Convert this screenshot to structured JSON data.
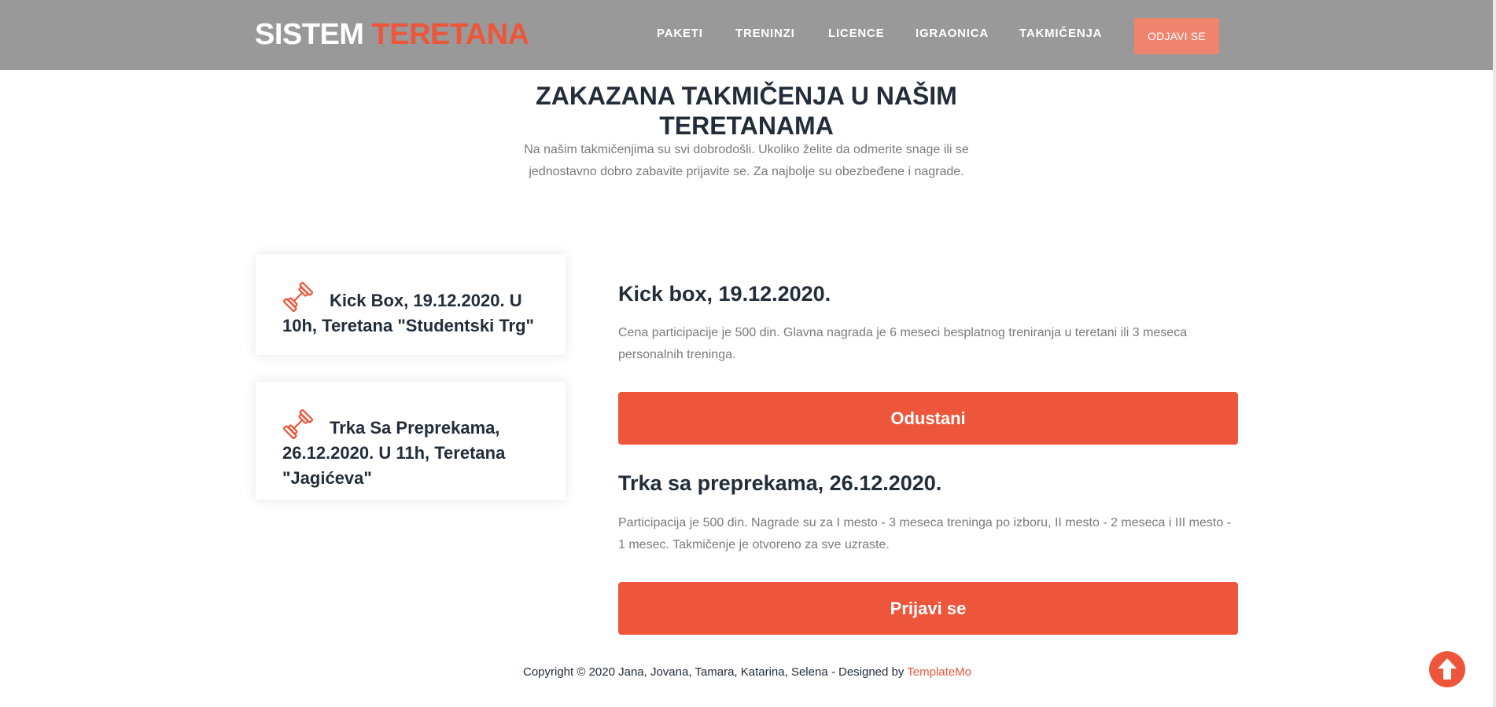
{
  "header": {
    "logo_part1": "SISTEM",
    "logo_part2": "TERETANA",
    "nav": {
      "paketi": "PAKETI",
      "treninzi": "TRENINZI",
      "licence": "LICENCE",
      "igraonica": "IGRAONICA",
      "takmicenja": "TAKMIČENJA"
    },
    "logout_label": "ODJAVI SE"
  },
  "section": {
    "title": "ZAKAZANA TAKMIČENJA U NAŠIM TERETANAMA",
    "subtitle": "Na našim takmičenjima su svi dobrodošli. Ukoliko želite da odmerite snage ili se jednostavno dobro zabavite prijavite se. Za najbolje su obezbeđene i nagrade."
  },
  "cards": [
    {
      "title": "Kick Box, 19.12.2020. U 10h, Teretana \"Studentski Trg\"",
      "icon": "dumbbell-icon"
    },
    {
      "title": "Trka Sa Preprekama, 26.12.2020. U 11h, Teretana \"Jagićeva\"",
      "icon": "dumbbell-icon"
    }
  ],
  "events": [
    {
      "title": "Kick box, 19.12.2020.",
      "description": "Cena participacije je 500 din. Glavna nagrada je 6 meseci besplatnog treniranja u teretani ili 3 meseca personalnih treninga.",
      "button_label": "Odustani"
    },
    {
      "title": "Trka sa preprekama, 26.12.2020.",
      "description": "Participacija je 500 din. Nagrade su za I mesto - 3 meseca treninga po izboru, II mesto - 2 meseca i III mesto - 1 mesec. Takmičenje je otvoreno za sve uzraste.",
      "button_label": "Prijavi se"
    }
  ],
  "footer": {
    "copyright": "Copyright © 2020 Jana, Jovana, Tamara, Katarina, Selena - Designed by",
    "designer_link": "TemplateMo"
  },
  "colors": {
    "accent": "#ed563b",
    "header_bg": "#999999",
    "logout_bg": "#f0846f",
    "heading": "#232d39",
    "text_muted": "#7a7a7a"
  },
  "icons": {
    "scroll_top": "arrow-up-circle-icon"
  }
}
